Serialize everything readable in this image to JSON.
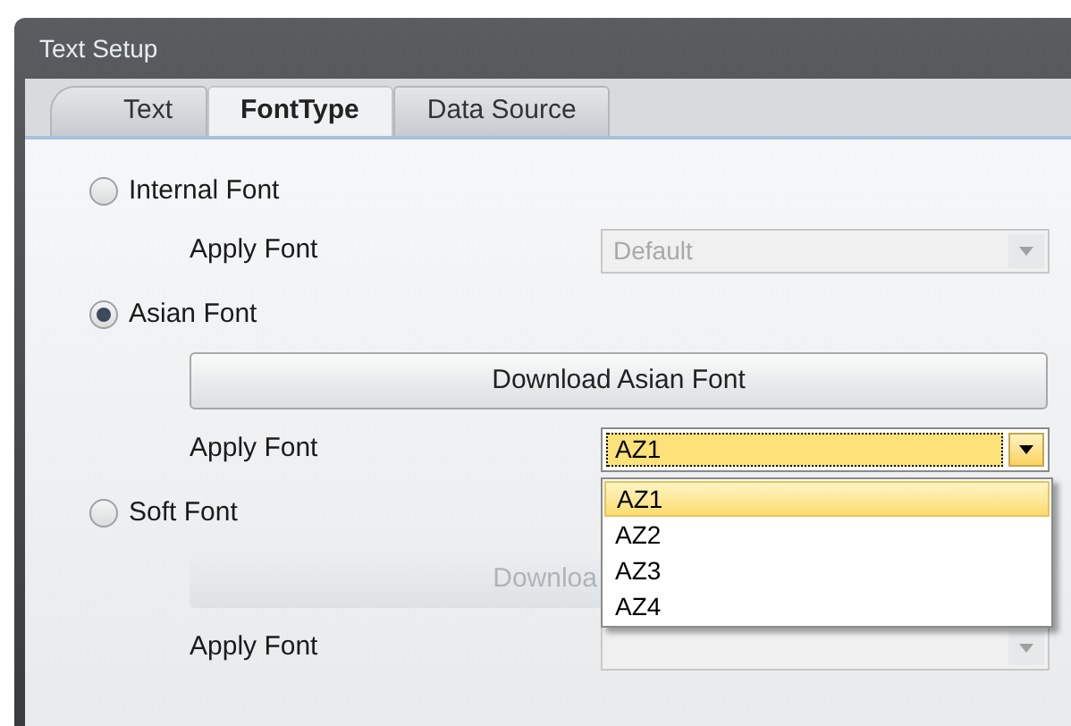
{
  "window": {
    "title": "Text Setup"
  },
  "tabs": [
    {
      "label": "Text",
      "selected": false
    },
    {
      "label": "FontType",
      "selected": true
    },
    {
      "label": "Data Source",
      "selected": false
    }
  ],
  "font_options": [
    {
      "label": "Internal Font",
      "selected": false,
      "apply_font": {
        "label": "Apply Font",
        "value": "Default",
        "disabled": true,
        "open": false
      }
    },
    {
      "label": "Asian Font",
      "selected": true,
      "download_button": {
        "label": "Download Asian Font",
        "disabled": false
      },
      "apply_font": {
        "label": "Apply Font",
        "value": "AZ1",
        "disabled": false,
        "open": true,
        "options": [
          {
            "label": "AZ1",
            "selected": true
          },
          {
            "label": "AZ2",
            "selected": false
          },
          {
            "label": "AZ3",
            "selected": false
          },
          {
            "label": "AZ4",
            "selected": false
          }
        ]
      }
    },
    {
      "label": "Soft Font",
      "selected": false,
      "download_button": {
        "label": "Downloa",
        "disabled": true
      },
      "apply_font": {
        "label": "Apply Font",
        "disabled": true,
        "open": false
      }
    }
  ]
}
